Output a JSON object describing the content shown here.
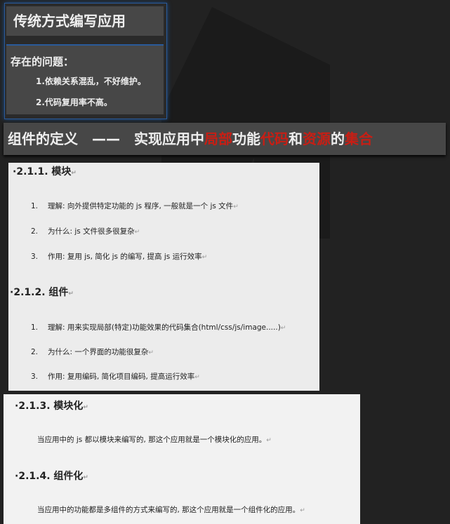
{
  "header": {
    "title": "传统方式编写应用"
  },
  "problems": {
    "title": "存在的问题：",
    "items": [
      "1.依赖关系混乱，不好维护。",
      "2.代码复用率不高。"
    ]
  },
  "banner": {
    "prefix": "组件的定义　——　实现应用中",
    "parts": [
      {
        "text": "局部",
        "red": true
      },
      {
        "text": "功能",
        "red": false
      },
      {
        "text": "代码",
        "red": true
      },
      {
        "text": "和",
        "red": false
      },
      {
        "text": "资源",
        "red": true
      },
      {
        "text": "的",
        "red": false
      },
      {
        "text": "集合",
        "red": true
      }
    ]
  },
  "doc1": {
    "sections": [
      {
        "heading": "2.1.1. 模块",
        "items": [
          {
            "num": "1.",
            "text": "理解: 向外提供特定功能的 js 程序, 一般就是一个 js 文件"
          },
          {
            "num": "2.",
            "text": "为什么:  js 文件很多很复杂"
          },
          {
            "num": "3.",
            "text": "作用: 复用 js, 简化 js 的编写, 提高 js 运行效率"
          }
        ]
      },
      {
        "heading": "2.1.2. 组件",
        "items": [
          {
            "num": "1.",
            "text": "理解: 用来实现局部(特定)功能效果的代码集合(html/css/js/image.....)"
          },
          {
            "num": "2.",
            "text": "为什么: 一个界面的功能很复杂"
          },
          {
            "num": "3.",
            "text": "作用: 复用编码, 简化项目编码, 提高运行效率"
          }
        ]
      }
    ]
  },
  "doc2": {
    "sections": [
      {
        "heading": "2.1.3. 模块化",
        "text": "当应用中的 js 都以模块来编写的, 那这个应用就是一个模块化的应用。"
      },
      {
        "heading": "2.1.4. 组件化",
        "text": "当应用中的功能都是多组件的方式来编写的, 那这个应用就是一个组件化的应用。"
      }
    ]
  },
  "paragraph_mark": "↵"
}
